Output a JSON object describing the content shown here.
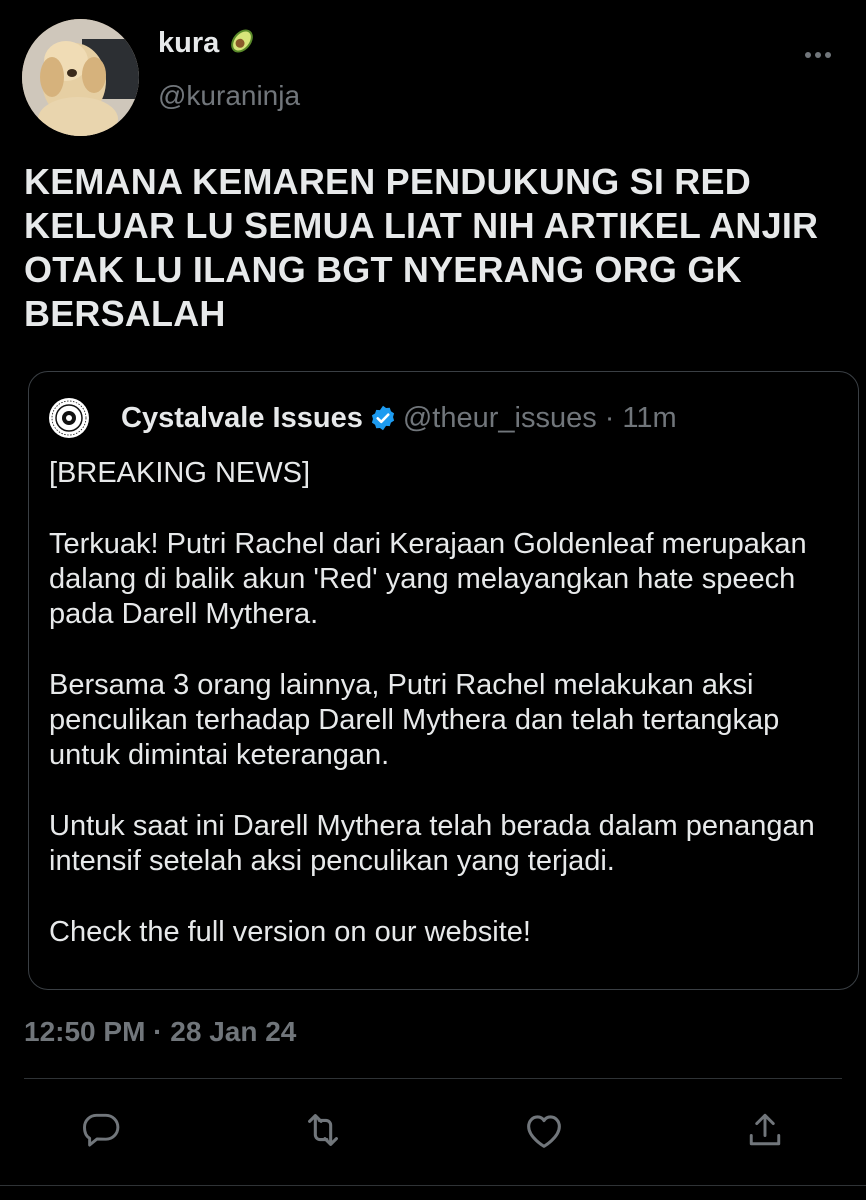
{
  "author": {
    "display_name": "kura",
    "emoji_icon": "avocado-icon",
    "handle": "@kuraninja"
  },
  "tweet": {
    "text": "KEMANA KEMAREN PENDUKUNG SI RED KELUAR LU SEMUA LIAT NIH ARTIKEL ANJIR OTAK LU ILANG BGT NYERANG ORG GK BERSALAH"
  },
  "quote": {
    "name": "Cystalvale Issues",
    "verified": true,
    "handle": "@theur_issues",
    "separator": "·",
    "time": "11m",
    "paragraphs": [
      "[BREAKING NEWS]",
      "Terkuak! Putri Rachel dari Kerajaan Goldenleaf merupakan dalang di balik akun 'Red' yang melayangkan hate speech pada Darell Mythera.",
      "Bersama 3 orang lainnya, Putri Rachel melakukan aksi penculikan terhadap Darell Mythera dan telah tertangkap untuk dimintai keterangan.",
      "Untuk saat ini Darell Mythera telah berada dalam penangan intensif setelah aksi penculikan yang terjadi.",
      "Check the full version on our website!"
    ]
  },
  "meta": {
    "timestamp": "12:50 PM · 28 Jan 24"
  },
  "actions": [
    "reply-icon",
    "retweet-icon",
    "like-icon",
    "share-icon"
  ],
  "colors": {
    "background": "#000000",
    "text": "#e7e9ea",
    "secondary": "#71767b",
    "border": "#3a3f44",
    "verified": "#1d9bf0"
  }
}
